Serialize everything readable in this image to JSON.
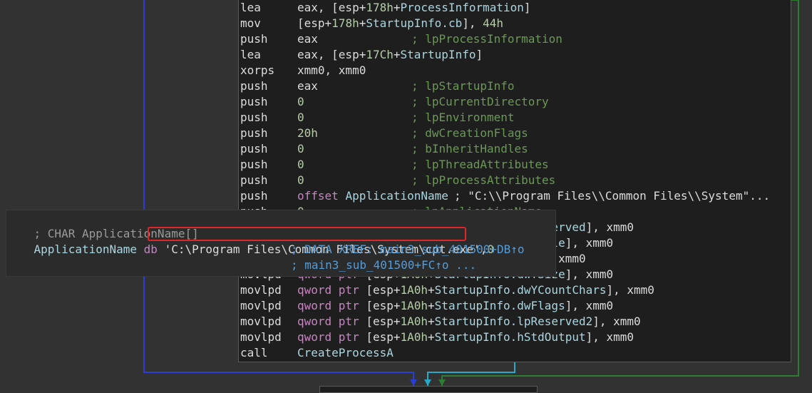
{
  "colors": {
    "background": "#323232",
    "node_bg": "#1e1e1e",
    "text": "#dcdcdc",
    "comment": "#6a9955",
    "number": "#b5cea8",
    "keyword": "#c586c0",
    "symbol": "#a9d6e0",
    "xref": "#569cd6",
    "highlight": "#e0252a",
    "edge_blue": "#2a3fcf",
    "edge_cyan": "#29a9c9",
    "edge_green": "#2e7d32"
  },
  "disassembly": [
    {
      "mnemonic": "lea",
      "op_parts": [
        "eax, [esp+",
        "178h",
        "+",
        "ProcessInformation",
        "]"
      ],
      "comment": ""
    },
    {
      "mnemonic": "mov",
      "op_parts": [
        "[esp+",
        "178h",
        "+",
        "StartupInfo.cb",
        "], ",
        "44h"
      ],
      "comment": ""
    },
    {
      "mnemonic": "push",
      "op_parts": [
        "eax"
      ],
      "comment": "; lpProcessInformation"
    },
    {
      "mnemonic": "lea",
      "op_parts": [
        "eax, [esp+",
        "17Ch",
        "+",
        "StartupInfo",
        "]"
      ],
      "comment": ""
    },
    {
      "mnemonic": "xorps",
      "op_parts": [
        "xmm0, xmm0"
      ],
      "comment": ""
    },
    {
      "mnemonic": "push",
      "op_parts": [
        "eax"
      ],
      "comment": "; lpStartupInfo"
    },
    {
      "mnemonic": "push",
      "op_parts": [
        "0"
      ],
      "comment": "; lpCurrentDirectory"
    },
    {
      "mnemonic": "push",
      "op_parts": [
        "0"
      ],
      "comment": "; lpEnvironment"
    },
    {
      "mnemonic": "push",
      "op_parts": [
        "20h"
      ],
      "comment": "; dwCreationFlags"
    },
    {
      "mnemonic": "push",
      "op_parts": [
        "0"
      ],
      "comment": "; bInheritHandles"
    },
    {
      "mnemonic": "push",
      "op_parts": [
        "0"
      ],
      "comment": "; lpThreadAttributes"
    },
    {
      "mnemonic": "push",
      "op_parts": [
        "0"
      ],
      "comment": "; lpProcessAttributes"
    },
    {
      "mnemonic": "push",
      "op_parts": [
        "offset",
        " ",
        "ApplicationName",
        " "
      ],
      "comment": "; \"C:\\\\Program Files\\\\Common Files\\\\System\"..."
    },
    {
      "mnemonic": "push",
      "op_parts": [
        "0"
      ],
      "comment": "; lpApplicationName"
    },
    {
      "mnemonic": "movlpd",
      "op_parts": [
        "qword ptr",
        " [esp+",
        "1A0h",
        "+",
        "StartupInfo.lpReserved",
        "], xmm0"
      ],
      "comment": ""
    },
    {
      "mnemonic": "movlpd",
      "op_parts": [
        "qword ptr",
        " [esp+",
        "1A0h",
        "+",
        "StartupInfo.lpTitle",
        "], xmm0"
      ],
      "comment": ""
    },
    {
      "mnemonic": "movlpd",
      "op_parts": [
        "qword ptr",
        " [esp+",
        "1A0h",
        "+",
        "StartupInfo.dwY",
        "], xmm0"
      ],
      "comment": ""
    },
    {
      "mnemonic": "movlpd",
      "op_parts": [
        "qword ptr",
        " [esp+",
        "1A0h",
        "+",
        "StartupInfo.dwYSize",
        "], xmm0"
      ],
      "comment": ""
    },
    {
      "mnemonic": "movlpd",
      "op_parts": [
        "qword ptr",
        " [esp+",
        "1A0h",
        "+",
        "StartupInfo.dwYCountChars",
        "], xmm0"
      ],
      "comment": ""
    },
    {
      "mnemonic": "movlpd",
      "op_parts": [
        "qword ptr",
        " [esp+",
        "1A0h",
        "+",
        "StartupInfo.dwFlags",
        "], xmm0"
      ],
      "comment": ""
    },
    {
      "mnemonic": "movlpd",
      "op_parts": [
        "qword ptr",
        " [esp+",
        "1A0h",
        "+",
        "StartupInfo.lpReserved2",
        "], xmm0"
      ],
      "comment": ""
    },
    {
      "mnemonic": "movlpd",
      "op_parts": [
        "qword ptr",
        " [esp+",
        "1A0h",
        "+",
        "StartupInfo.hStdOutput",
        "], xmm0"
      ],
      "comment": ""
    },
    {
      "mnemonic": "call",
      "op_parts": [
        "CreateProcessA"
      ],
      "comment": ""
    }
  ],
  "popup": {
    "comment_prefix": "; CHAR ",
    "comment_name": "ApplicationName",
    "comment_suffix": "[]",
    "symbol": "ApplicationName",
    "directive": "db",
    "quote": "'",
    "string_value": "C:\\Program Files\\Common Files\\System\\cpt.exe",
    "terminator_prefix": "',",
    "terminator_value": "0",
    "xref1": "; DATA XREF: main3_sub_401500+DB↑o",
    "xref2": "; main3_sub_401500+FC↑o ..."
  }
}
